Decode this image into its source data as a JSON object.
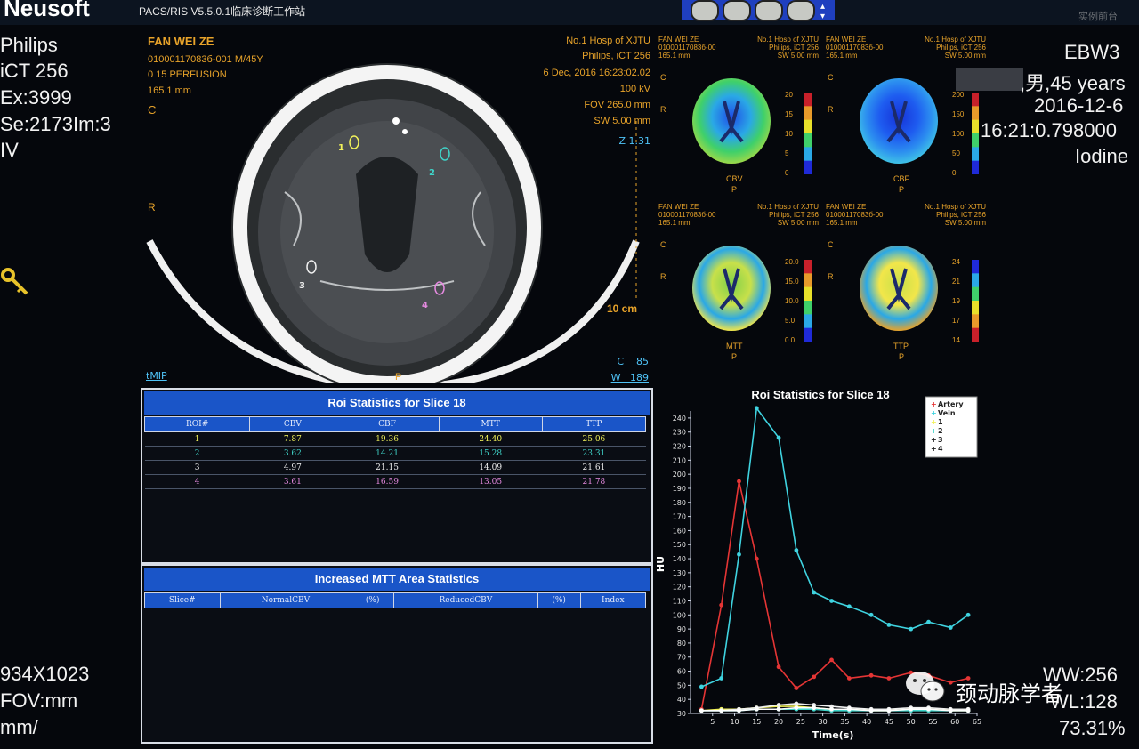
{
  "header": {
    "brand": "Neusoft",
    "app_title": "PACS/RIS V5.5.0.1临床诊断工作站",
    "top_right": "实例前台"
  },
  "left_info": {
    "manufacturer": "Philips",
    "scanner": "iCT 256",
    "exam": "Ex:3999",
    "series": "Se:2173Im:3",
    "modality": "IV",
    "matrix": "934X1023",
    "fov": "FOV:mm",
    "mm": "mm/"
  },
  "right_info": {
    "id": "EBW3",
    "patient": ",男,45 years",
    "date": "2016-12-6",
    "time": "16:21:0.798000",
    "contrast": "Iodine",
    "ww": "WW:256",
    "wl": "WL:128",
    "zoom": "73.31%"
  },
  "ct_image": {
    "patient_name": "FAN WEI ZE",
    "patient_id": "01000117083б-001 M/45Y",
    "series_desc": "0 15 PERFUSION",
    "position": "165.1 mm",
    "orient_top": "C",
    "orient_left": "R",
    "orient_bottom": "P",
    "hospital": "No.1 Hosp of XJTU",
    "scanner": "Philips, iCT 256",
    "datetime": "6 Dec, 2016 16:23:02.02",
    "kv": "100 kV",
    "fov": "FOV 265.0 mm",
    "sw": "SW 5.00 mm",
    "zoom": "Z 1.31",
    "scale": "10 cm",
    "tmip": "tMIP",
    "c_value": "C    85",
    "w_value": "W   189",
    "roi_labels": [
      "1",
      "2",
      "3",
      "4"
    ]
  },
  "maps": [
    {
      "name": "CBV",
      "scale": [
        "20",
        "15",
        "10",
        "5",
        "0"
      ],
      "header": [
        "FAN WEI ZE",
        "01000117083б-00",
        "165.1 mm"
      ],
      "header_r": [
        "No.1 Hosp of XJTU",
        "Philips, iCT 256",
        "SW 5.00 mm"
      ]
    },
    {
      "name": "CBF",
      "scale": [
        "200",
        "150",
        "100",
        "50",
        "0"
      ],
      "header": [
        "FAN WEI ZE",
        "01000117083б-00",
        "165.1 mm"
      ],
      "header_r": [
        "No.1 Hosp of XJTU",
        "Philips, iCT 256",
        "SW 5.00 mm"
      ]
    },
    {
      "name": "MTT",
      "scale": [
        "20.0",
        "15.0",
        "10.0",
        "5.0",
        "0.0"
      ],
      "header": [
        "FAN WEI ZE",
        "01000117083б-00",
        "165.1 mm"
      ],
      "header_r": [
        "No.1 Hosp of XJTU",
        "Philips, iCT 256",
        "SW 5.00 mm"
      ]
    },
    {
      "name": "TTP",
      "scale": [
        "24",
        "21",
        "19",
        "17",
        "14"
      ],
      "header": [
        "FAN WEI ZE",
        "01000117083б-00",
        "165.1 mm"
      ],
      "header_r": [
        "No.1 Hosp of XJTU",
        "Philips, iCT 256",
        "SW 5.00 mm"
      ]
    }
  ],
  "map_orient": {
    "top": "C",
    "left": "R",
    "bottom": "P"
  },
  "roi_table": {
    "title": "Roi Statistics for Slice 18",
    "columns": [
      "ROI#",
      "CBV",
      "CBF",
      "MTT",
      "TTP"
    ],
    "rows": [
      {
        "cells": [
          "1",
          "7.87",
          "19.36",
          "24.40",
          "25.06"
        ],
        "color": "#f2f25a"
      },
      {
        "cells": [
          "2",
          "3.62",
          "14.21",
          "15.28",
          "23.31"
        ],
        "color": "#3fd3c8"
      },
      {
        "cells": [
          "3",
          "4.97",
          "21.15",
          "14.09",
          "21.61"
        ],
        "color": "#f0f0f0"
      },
      {
        "cells": [
          "4",
          "3.61",
          "16.59",
          "13.05",
          "21.78"
        ],
        "color": "#e58ae0"
      }
    ]
  },
  "mtt_table": {
    "title": "Increased MTT Area Statistics",
    "columns": [
      "Slice#",
      "NormalCBV",
      "(%)",
      "ReducedCBV",
      "(%)",
      "Index"
    ]
  },
  "chart_data": {
    "type": "line",
    "title": "Roi Statistics for Slice 18",
    "xlabel": "Time(s)",
    "ylabel": "HU",
    "xlim": [
      0,
      65
    ],
    "ylim": [
      30,
      245
    ],
    "xticks": [
      5,
      10,
      15,
      20,
      25,
      30,
      35,
      40,
      45,
      50,
      55,
      60,
      65
    ],
    "yticks": [
      30,
      40,
      50,
      60,
      70,
      80,
      90,
      100,
      110,
      120,
      130,
      140,
      150,
      160,
      170,
      180,
      190,
      200,
      210,
      220,
      230,
      240
    ],
    "legend_position": "top-right",
    "series": [
      {
        "name": "Artery",
        "color": "#e53535",
        "x": [
          2.5,
          7,
          11,
          15,
          20,
          24,
          28,
          32,
          36,
          41,
          45,
          50,
          54,
          59,
          63
        ],
        "y": [
          33,
          107,
          195,
          140,
          63,
          48,
          56,
          68,
          55,
          57,
          55,
          59,
          57,
          52,
          55
        ]
      },
      {
        "name": "Vein",
        "color": "#3fd3e0",
        "x": [
          2.5,
          7,
          11,
          15,
          20,
          24,
          28,
          32,
          36,
          41,
          45,
          50,
          54,
          59,
          63
        ],
        "y": [
          49,
          55,
          143,
          247,
          226,
          146,
          116,
          110,
          106,
          100,
          93,
          90,
          95,
          91,
          100
        ]
      },
      {
        "name": "1",
        "color": "#f2f25a",
        "x": [
          2.5,
          7,
          11,
          15,
          20,
          24,
          28,
          32,
          36,
          41,
          45,
          50,
          54,
          59,
          63
        ],
        "y": [
          32,
          33,
          33,
          34,
          35,
          35,
          34,
          33,
          33,
          32,
          32,
          33,
          33,
          32,
          32
        ]
      },
      {
        "name": "2",
        "color": "#3fd3c8",
        "x": [
          2.5,
          7,
          11,
          15,
          20,
          24,
          28,
          32,
          36,
          41,
          45,
          50,
          54,
          59,
          63
        ],
        "y": [
          32,
          32,
          32,
          33,
          33,
          33,
          33,
          32,
          32,
          32,
          32,
          32,
          32,
          32,
          32
        ]
      },
      {
        "name": "3",
        "color": "#f0f0f0",
        "x": [
          2.5,
          7,
          11,
          15,
          20,
          24,
          28,
          32,
          36,
          41,
          45,
          50,
          54,
          59,
          63
        ],
        "y": [
          32,
          32,
          33,
          34,
          36,
          37,
          36,
          35,
          34,
          33,
          33,
          34,
          34,
          33,
          33
        ]
      },
      {
        "name": "4",
        "color": "#ffffff",
        "x": [
          2.5,
          7,
          11,
          15,
          20,
          24,
          28,
          32,
          36,
          41,
          45,
          50,
          54,
          59,
          63
        ],
        "y": [
          32,
          32,
          32,
          33,
          33,
          34,
          34,
          33,
          33,
          32,
          32,
          33,
          33,
          32,
          32
        ]
      }
    ]
  },
  "watermark": "颈动脉学者",
  "colors": {
    "orange": "#e8a32a",
    "panel_blue": "#1a55c8",
    "link_cyan": "#4fc3f7"
  }
}
